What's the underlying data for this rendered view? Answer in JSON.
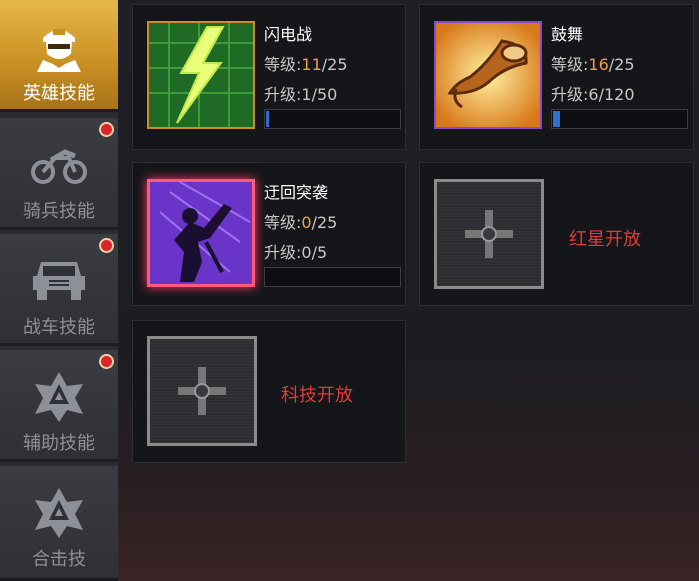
{
  "sidebar": {
    "items": [
      {
        "label": "英雄技能",
        "icon": "soldier-head-icon",
        "active": true,
        "badge": false
      },
      {
        "label": "骑兵技能",
        "icon": "motorcycle-icon",
        "active": false,
        "badge": true
      },
      {
        "label": "战车技能",
        "icon": "jeep-icon",
        "active": false,
        "badge": true
      },
      {
        "label": "辅助技能",
        "icon": "emblem-icon",
        "active": false,
        "badge": true
      },
      {
        "label": "合击技",
        "icon": "emblem-icon",
        "active": false,
        "badge": false
      }
    ]
  },
  "skills": [
    {
      "name": "闪电战",
      "level_label": "等级:",
      "level_current": "11",
      "level_max": "/25",
      "upgrade": "升级:1/50",
      "progress": 0.02,
      "icon": "lightning-map-icon"
    },
    {
      "name": "鼓舞",
      "level_label": "等级:",
      "level_current": "16",
      "level_max": "/25",
      "upgrade": "升级:6/120",
      "progress": 0.05,
      "icon": "war-horn-icon"
    },
    {
      "name": "迂回突袭",
      "level_label": "等级:",
      "level_current": "0",
      "level_max": "/25",
      "upgrade": "升级:0/5",
      "progress": 0,
      "icon": "assassin-strike-icon"
    }
  ],
  "locked": [
    {
      "text": "红星开放",
      "icon": "plus-icon"
    },
    {
      "text": "科技开放",
      "icon": "plus-icon"
    }
  ],
  "colors": {
    "active_tab": "#d9a23a",
    "level_current": "#f0a040",
    "locked_text": "#e2393b",
    "badge": "#d9242b",
    "progress": "#2f6fd0"
  }
}
